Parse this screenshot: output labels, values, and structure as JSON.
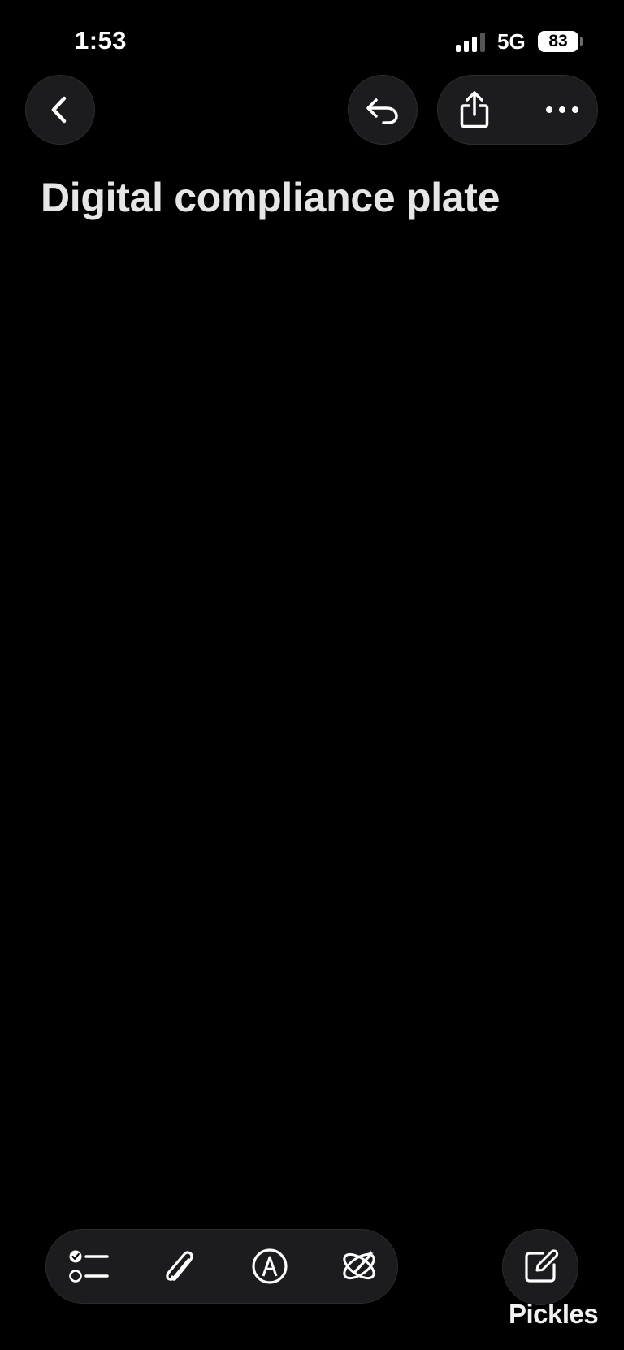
{
  "status_bar": {
    "time": "1:53",
    "network": "5G",
    "battery_level": "83",
    "signal_bars_active": 3,
    "signal_bars_total": 4
  },
  "toolbar_top": {
    "back_icon": "chevron-left-icon",
    "undo_icon": "undo-arrow-icon",
    "share_icon": "share-icon",
    "more_icon": "ellipsis-icon"
  },
  "note": {
    "title": "Digital compliance plate",
    "body": ""
  },
  "toolbar_bottom": {
    "checklist_icon": "checklist-icon",
    "attachment_icon": "paperclip-icon",
    "markup_icon": "pen-markup-icon",
    "writing_tools_icon": "writing-tools-icon",
    "compose_icon": "compose-icon"
  },
  "watermark": {
    "text": "Pickles"
  },
  "colors": {
    "background": "#000000",
    "button_fill": "#1c1c1e",
    "title_text": "#e6e6e6",
    "icon": "#ffffff"
  }
}
